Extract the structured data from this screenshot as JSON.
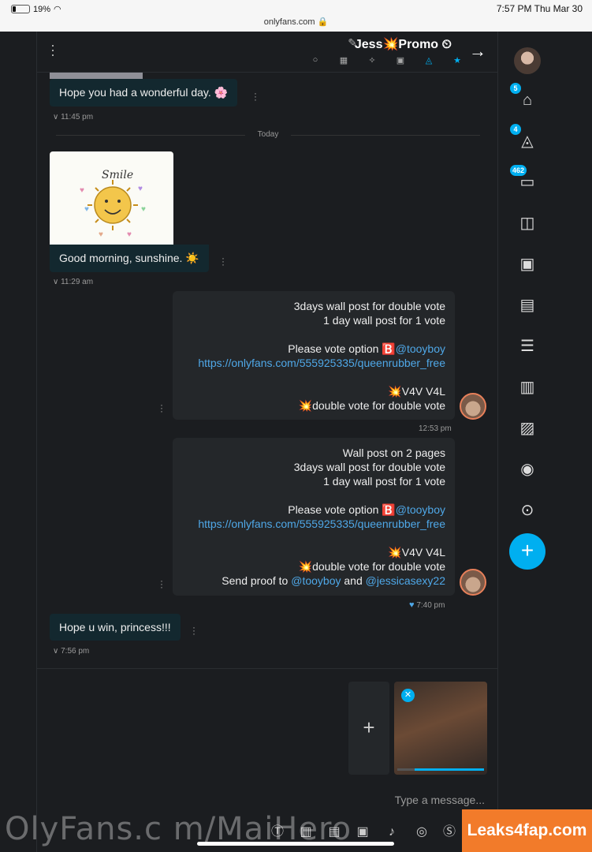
{
  "status_bar": {
    "battery": "19%",
    "time": "7:57 PM  Thu Mar 30",
    "url": "onlyfans.com 🔒"
  },
  "header": {
    "title": "Jess💥Promo ⏲",
    "edit_icon": "pencil-icon",
    "icons": [
      "star-icon",
      "bell-icon",
      "box-icon",
      "pin-icon",
      "image-icon",
      "search-icon"
    ]
  },
  "messages": {
    "m1": {
      "text": "Hope you had a wonderful day. 🌸",
      "time": "11:45 pm"
    },
    "divider": "Today",
    "m2": {
      "text": "Good morning, sunshine. ☀️",
      "time": "11:29 am",
      "image_caption": "Smile"
    },
    "m3": {
      "line1": "3days wall post for double vote",
      "line2": "1 day wall post for 1 vote",
      "line3_prefix": "Please vote option 🅱️",
      "line3_mention": "@tooyboy",
      "link": "https://onlyfans.com/555925335/queenrubber_free",
      "line4": "💥V4V V4L",
      "line5": "💥double vote for double vote",
      "time": "12:53 pm"
    },
    "m4": {
      "line0": "Wall post on 2 pages",
      "line1": "3days wall post for double vote",
      "line2": "1 day wall post for 1 vote",
      "line3_prefix": "Please vote option 🅱️",
      "line3_mention": "@tooyboy",
      "link": "https://onlyfans.com/555925335/queenrubber_free",
      "line4": "💥V4V V4L",
      "line5": "💥double vote for double vote",
      "line6_prefix": "Send proof to",
      "line6_mention1": "@tooyboy",
      "line6_and": "and",
      "line6_mention2": "@jessicasexy22",
      "time": "7:40 pm"
    },
    "m5": {
      "text": "Hope u win, princess!!!",
      "time": "7:56 pm"
    }
  },
  "compose": {
    "placeholder": "Type a message...",
    "upload_progress": 0.8,
    "tools": [
      "dollar-icon",
      "target-icon",
      "mic-icon",
      "image-icon",
      "calendar-icon",
      "gift-icon",
      "text-icon",
      "send-icon"
    ]
  },
  "sidebar": {
    "badges": {
      "home": "5",
      "notifications": "4",
      "messages": "462"
    }
  },
  "watermark": {
    "text": "OlyFans.c m/MaiHero",
    "badge": "Leaks4fap.com"
  },
  "colors": {
    "accent": "#00aff0",
    "bg": "#1b1d20",
    "bubble_in": "#13282f",
    "bubble_out": "#24272a"
  }
}
